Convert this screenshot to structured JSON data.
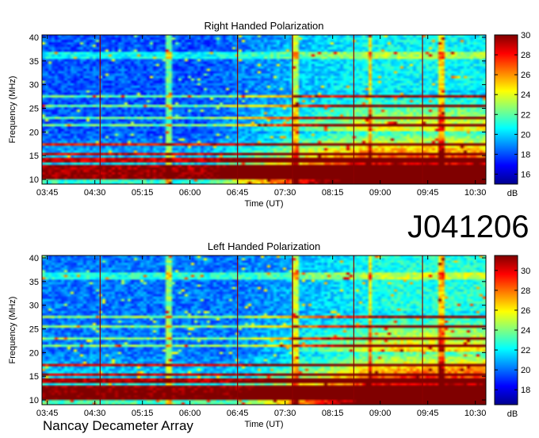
{
  "figure": {
    "observation_id": "J041206",
    "instrument": "Nancay Decameter Array"
  },
  "colors": {
    "colormap": [
      "#00008f",
      "#0000ff",
      "#0080ff",
      "#00ffff",
      "#80ff80",
      "#ffff00",
      "#ff8000",
      "#ff0000",
      "#800000"
    ],
    "frame": "#000000",
    "vertical_marker": "#8b0000"
  },
  "chart_data": [
    {
      "type": "heatmap",
      "title": "Right Handed Polarization",
      "xlabel": "Time (UT)",
      "ylabel": "Frequency (MHz)",
      "x_ticks": [
        "03:45",
        "04:30",
        "05:15",
        "06:00",
        "06:45",
        "07:30",
        "08:15",
        "09:00",
        "09:45",
        "10:30"
      ],
      "xlim": [
        "03:40",
        "10:40"
      ],
      "y_ticks": [
        10,
        15,
        20,
        25,
        30,
        35,
        40
      ],
      "ylim": [
        9,
        40.5
      ],
      "colorbar": {
        "label": "dB",
        "ticks": [
          16,
          18,
          20,
          22,
          24,
          26,
          28,
          30
        ],
        "range": [
          15,
          30
        ]
      },
      "vertical_markers": [
        "04:35",
        "06:45",
        "07:37",
        "08:35",
        "09:40"
      ],
      "features": {
        "background_level_db": 17,
        "strong_bands_mhz": [
          10.5,
          11.5,
          12.5,
          14,
          15.5,
          17.5,
          21.5,
          23,
          25.5,
          27.5
        ],
        "high_emission_region": {
          "start": "07:15",
          "end": "10:40",
          "freq_range": [
            10,
            20
          ],
          "level_db": 30
        },
        "bright_vertical_lines": [
          "05:40",
          "07:40",
          "08:50",
          "09:58"
        ]
      }
    },
    {
      "type": "heatmap",
      "title": "Left Handed Polarization",
      "xlabel": "Time (UT)",
      "ylabel": "Frequency (MHz)",
      "x_ticks": [
        "03:45",
        "04:30",
        "05:15",
        "06:00",
        "06:45",
        "07:30",
        "08:15",
        "09:00",
        "09:45",
        "10:30"
      ],
      "xlim": [
        "03:40",
        "10:40"
      ],
      "y_ticks": [
        10,
        15,
        20,
        25,
        30,
        35,
        40
      ],
      "ylim": [
        9,
        40.5
      ],
      "colorbar": {
        "label": "dB",
        "ticks": [
          18,
          20,
          22,
          24,
          26,
          28,
          30
        ],
        "range": [
          16.5,
          31.5
        ]
      },
      "vertical_markers": [
        "04:35",
        "06:45",
        "07:37",
        "08:35",
        "09:40"
      ],
      "features": {
        "background_level_db": 19,
        "strong_bands_mhz": [
          10.5,
          11.5,
          12.5,
          14,
          15.5,
          17.5,
          21.5,
          23,
          25.5,
          27.5
        ],
        "high_emission_region": {
          "start": "07:45",
          "end": "10:40",
          "freq_range": [
            10,
            20
          ],
          "level_db": 31
        },
        "bright_vertical_lines": [
          "05:40",
          "07:40",
          "08:50",
          "09:58"
        ]
      }
    }
  ]
}
